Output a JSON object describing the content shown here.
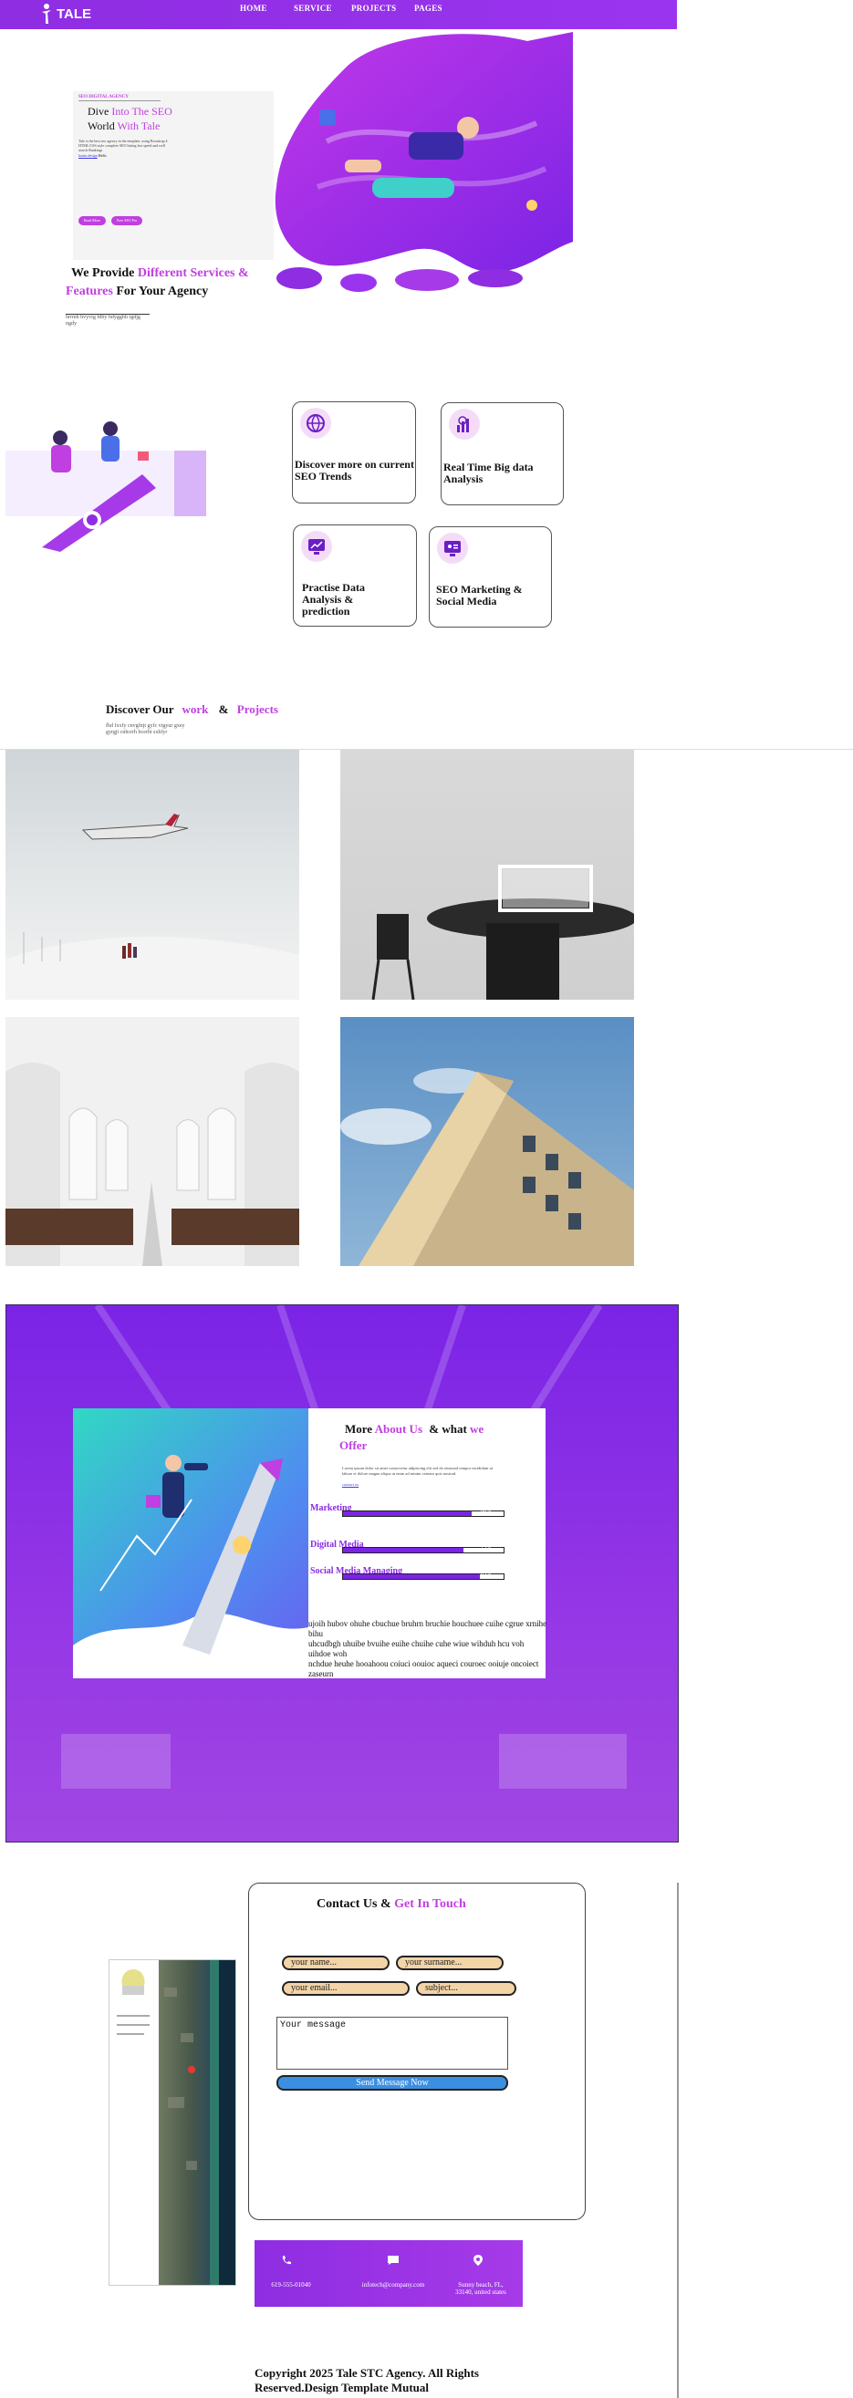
{
  "nav": {
    "logo": "TALE",
    "links": [
      "HOME",
      "SERVICE",
      "PROJECTS",
      "PAGES"
    ]
  },
  "hero": {
    "kicker": "SEO DIGITAL AGENCY",
    "headline_a": "Dive",
    "headline_b": "Into The SEO",
    "headline_c": "World",
    "headline_d": "With Tale",
    "body": "Tale is the best seo agency in the template, using Bootstrap 4 HTML/CSS style complete SEO listing fast speed and well search Rankings",
    "link_text": "karim.design",
    "link_suffix": "Hello",
    "btn_primary": "Read More",
    "btn_secondary": "Free SEO Pro"
  },
  "provide": {
    "a": "We Provide",
    "b": "Different Services &",
    "c": "Features",
    "d": "For Your Agency",
    "sub": "hrrmh hvyvig fdby hdygghh rgdjg ngdy"
  },
  "services": [
    {
      "title": "Discover more on current SEO Trends",
      "icon": "globe-dollar-icon"
    },
    {
      "title": "Real Time Big data Analysis",
      "icon": "bar-chart-icon"
    },
    {
      "title": "Practise Data Analysis & prediction",
      "icon": "monitor-chart-icon"
    },
    {
      "title": "SEO Marketing & Social Media",
      "icon": "social-screen-icon"
    }
  ],
  "projects": {
    "a": "Discover Our",
    "b": "work",
    "c": "&",
    "d": "Projects",
    "sub": "fhd fxxfy cnvgfnjt gyfc vtgyur gxey gyrgjt cnhcrrh bcerhi sxhfyr"
  },
  "about": {
    "a": "More",
    "b": "About Us",
    "c": "& what",
    "d": "we",
    "e": "Offer",
    "body": "Lorem ipsum dolor sit amet consectetur adipiscing elit sed do eiusmod tempor incididunt ut labore et dolore magna aliqua ut enim ad minim veniam quis nostrud.",
    "link": "contact us",
    "skills": [
      {
        "label": "Marketing",
        "percent": 80,
        "pct_text": "80%"
      },
      {
        "label": "Digital Media",
        "percent": 75,
        "pct_text": "75%"
      },
      {
        "label": "Social Media Managing",
        "percent": 85,
        "pct_text": "85%"
      }
    ],
    "footer_text": [
      "ujoih hubov ohuhe cbuchue bruhrn bruchie houchuee cuihe cgrue xrnihe bihu",
      "uhcudbgh uhuibe bvuihe euihe chuihe cuhe wiue wihduh hcu voh uihdoe woh",
      "nchdue heuhe hooahoou coiuci oouioc aqueci couroec ooiuje oncoiect zaseurn"
    ]
  },
  "contact": {
    "a": "Contact Us &",
    "b": "Get In Touch",
    "name_ph": "your name...",
    "surname_ph": "your surname...",
    "email_ph": "your email...",
    "subject_ph": "subject...",
    "message_ph": "Your message",
    "send": "Send Message Now"
  },
  "info": {
    "phone": "619-555-01040",
    "email": "infotech@company.com",
    "address_a": "Sunny beach, FL,",
    "address_b": "33140, united states"
  },
  "footer": {
    "line1": "Copyright 2025 Tale STC Agency. All Rights",
    "line2": "Reserved.Design Template Mutual"
  },
  "colors": {
    "purple": "#8e2de2",
    "magenta": "#c03fe0",
    "accent_btn": "#3b8fe0",
    "field_bg": "#f3d4a6"
  }
}
